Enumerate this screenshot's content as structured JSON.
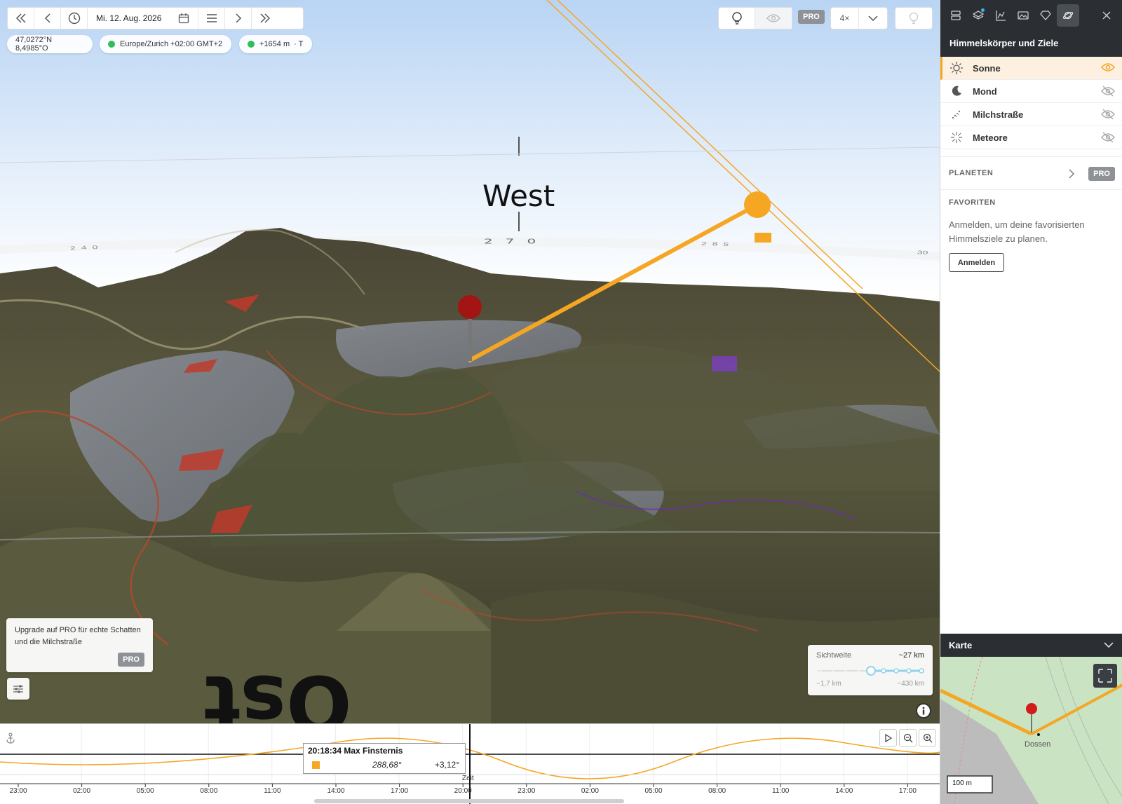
{
  "toolbar": {
    "date": "Mi. 12. Aug. 2026"
  },
  "status": {
    "coords": "47,0272°N 8,4985°O",
    "timezone": "Europe/Zurich  +02:00 GMT+2",
    "elevation": "+1654 m",
    "elevation_suffix": "· T"
  },
  "top_right": {
    "pro_label": "PRO",
    "speed": "4×"
  },
  "scene": {
    "direction_label": "West",
    "bottom_label": "Ost",
    "compass_ticks": [
      "240",
      "270",
      "285",
      "30"
    ]
  },
  "upgrade_card": {
    "text": "Upgrade auf PRO für echte Schatten und die Milchstraße",
    "badge": "PRO"
  },
  "visibility": {
    "label": "Sichtweite",
    "value": "~27 km",
    "min": "~1,7 km",
    "max": "~430 km",
    "level": 0.5
  },
  "panel": {
    "title": "Himmelskörper und Ziele",
    "items": [
      {
        "label": "Sonne",
        "icon": "sun-icon",
        "visible": true
      },
      {
        "label": "Mond",
        "icon": "moon-icon",
        "visible": false
      },
      {
        "label": "Milchstraße",
        "icon": "milky-way-icon",
        "visible": false
      },
      {
        "label": "Meteore",
        "icon": "meteor-icon",
        "visible": false
      }
    ],
    "planets_label": "PLANETEN",
    "planets_badge": "PRO",
    "favorites_label": "FAVORITEN",
    "favorites_text": "Anmelden, um deine favorisierten Himmelsziele zu planen.",
    "login_button": "Anmelden"
  },
  "map": {
    "title": "Karte",
    "place": "Dossen",
    "scale": "100 m"
  },
  "timeline": {
    "tooltip_title": "20:18:34 Max Finsternis",
    "tooltip_azimuth": "288,68°",
    "tooltip_altitude": "+3,12°",
    "time_label": "Zeit",
    "ticks": [
      "23:00",
      "02:00",
      "05:00",
      "08:00",
      "11:00",
      "14:00",
      "17:00",
      "20:00",
      "23:00",
      "02:00",
      "05:00",
      "08:00",
      "11:00",
      "14:00",
      "17:00"
    ]
  },
  "colors": {
    "accent": "#f5a623",
    "panel_dark": "#2b2f33",
    "status_green": "#2fbf5a"
  }
}
